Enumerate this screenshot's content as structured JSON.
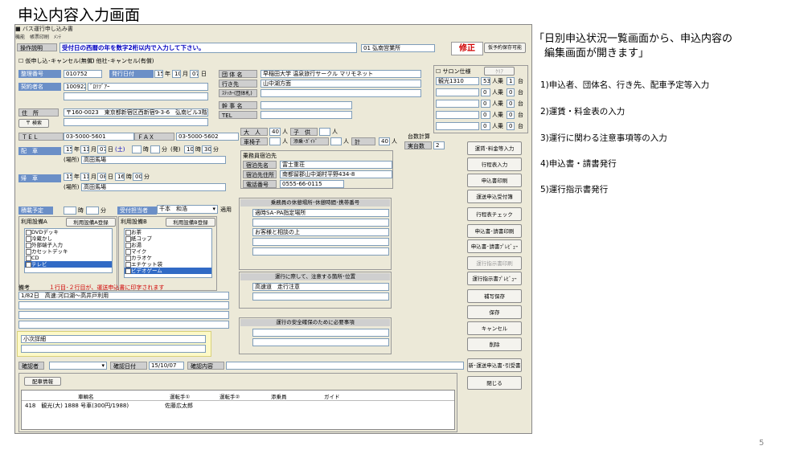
{
  "slide": {
    "title": "申込内容入力画面",
    "note_lines": [
      "「日別申込状況一覧画面から、申込内容の",
      "　編集画面が開きます」"
    ],
    "steps": [
      "1)申込者、団体名、行き先、配車予定等入力",
      "2)運賃・料金表の入力",
      "3)運行に関わる注意事項等の入力",
      "4)申込書・請書発行",
      "5)運行指示書発行"
    ],
    "page_number": "5"
  },
  "window": {
    "title": "バス運行申し込み書",
    "menu": "機能　帳票印刷　ﾒﾝﾃ",
    "instruction_label": "操作説明",
    "instruction_text": "受付日の西暦の年を数字2桁以内で入力して下さい。",
    "office": "01 弘南営業所",
    "mode": "修正",
    "provisional_btn": "仮予約保存可能",
    "check_tentative": "仮申し込･キャンセル(無償)",
    "check_other": "他社･キャンセル(有償)"
  },
  "form": {
    "reg_no_label": "整理番号",
    "reg_no": "010752",
    "issue_label": "発行日付",
    "issue_yy": "15",
    "issue_mm": "10",
    "issue_dd": "07",
    "ymd": [
      "年",
      "月",
      "日"
    ],
    "contract_label": "契約者名",
    "contract_code": "100922",
    "contract_name": "ﾞﾛﾘﾂﾞｱｰ",
    "address_label": "住　所",
    "address": "〒160-0023　東京都新宿区西新宿9-3-6　弘南ビル3階",
    "search_btn": "〒 検索",
    "tel_label": "ＴＥＬ",
    "tel": "03-5000-5601",
    "fax_label": "ＦＡＸ",
    "fax": "03-5000-5602",
    "dispatch_label": "配　車",
    "dispatch_y": "15",
    "dispatch_m": "11",
    "dispatch_d": "07",
    "dispatch_dow": "(土)",
    "time_h": "時",
    "time_m": "分",
    "arrive": "(発)",
    "dispatch_h": "10",
    "dispatch_min": "30",
    "place_label": "(場所)",
    "dispatch_place": "高田馬場",
    "return_label": "帰　車",
    "return_y": "15",
    "return_m": "11",
    "return_d": "08",
    "return_h": "16",
    "return_min": "00",
    "return_place": "高田馬場",
    "group_label": "団 体 名",
    "group_name": "早稲田大学 温泉旅行サークル マリモネット",
    "dest_label": "行き先",
    "destination": "山中湖方面",
    "sticker_label": "ｽﾃｯｶｰ(団体札)",
    "leader_label": "幹 事 名",
    "tel2_label": "TEL",
    "adult_label": "大　人",
    "adult": "40",
    "person": "人",
    "child_label": "子　供",
    "vehicle_label": "車椅子",
    "guide_label": "添乗･ｶﾞｲﾄﾞ",
    "total_label": "計",
    "total": "40",
    "stay_header": "乗務員宿泊先",
    "stay_name_label": "宿泊先名",
    "stay_name": "富士重荘",
    "stay_addr_label": "宿泊先住所",
    "stay_addr": "南都留郡山中湖村平野434-8",
    "stay_tel_label": "電話番号",
    "stay_tel": "0555-66-0115",
    "rest_header": "乗務員の休憩場所･休憩時間･携帯番号",
    "rest_1": "適時SA･PA指定場所",
    "rest_2": "お客様と相談の上",
    "caution_header": "運行に際して、注意する箇所･位置",
    "caution_1": "高速道　走行注意",
    "safety_header": "運行の安全確保のために必要事項",
    "bus_count_label": "台数計算",
    "bus_count_label2": "実台数",
    "bus_count": "2",
    "salon_label": "サロン仕様",
    "clear_btn": "ｸﾘｱ",
    "car_type": "観光1310",
    "car_seats": "53",
    "car_qty": "1",
    "car_unit": "台",
    "seat_unit": "人乗",
    "row_zero": "0",
    "luggage_label": "積載予定",
    "staff_label": "受付担当者",
    "staff": "千本　和浩",
    "apply_btn": "適用",
    "eqa_label": "利用設備A",
    "eqa_btn": "利用設備A登録",
    "eqb_label": "利用設備B",
    "eqb_btn": "利用設備B登録",
    "eqa_items": [
      "DVDデッキ",
      "冷蔵かし",
      "外部端子入力",
      "カセットデッキ",
      "CD",
      "テレビ"
    ],
    "eqb_items": [
      "お茶",
      "紙コップ",
      "お湯",
      "マイク",
      "カラオケ",
      "エチケット袋",
      "ビデオゲーム"
    ],
    "memo_label": "備考",
    "memo_note": "１行目･２行目が、運送申込書に印字されます",
    "memo_1": "1/82日　高速:河口湖～高井戸利用",
    "sub_label": "小次詳細",
    "confirm_label": "確認者",
    "confirm_date_label": "確認日付",
    "confirm_date": "15/10/07",
    "confirm_content": "確認内容"
  },
  "assign": {
    "tab": "配車情報",
    "headers": [
      "車輌名",
      "運転手①",
      "運転手②",
      "添乗員",
      "ガイド"
    ],
    "row": [
      "418　観光(大) 1888 号車(300円/1988)",
      "佐藤広太郎",
      "",
      "",
      ""
    ]
  },
  "buttons": [
    "運賃･料金等入力",
    "行程表入力",
    "申込書印刷",
    "運送申込受付簿",
    "行程表チェック",
    "申込書･請書印刷",
    "申込書･請書ﾌﾟﾚﾋﾞｭｰ",
    "運行指示書印刷",
    "運行指示書ﾌﾟﾚﾋﾞｭｰ",
    "補写保存",
    "保存",
    "キャンセル",
    "削除",
    "新･運送申込書･引受書",
    "閉じる"
  ]
}
